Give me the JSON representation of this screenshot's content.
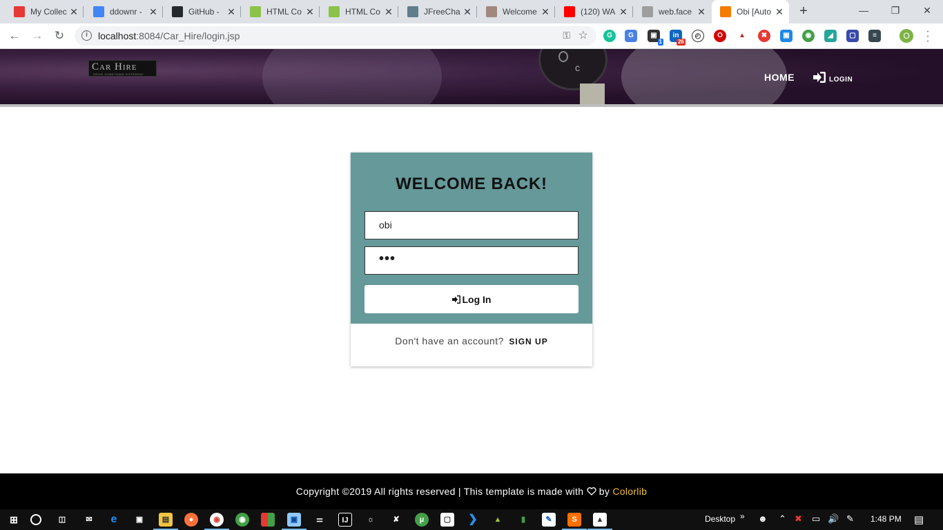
{
  "browser": {
    "tabs": [
      {
        "title": "My Collec",
        "icon": "red-collection-icon",
        "color": "#e53935"
      },
      {
        "title": "ddownr -",
        "icon": "ddownr-icon",
        "color": "#4285f4"
      },
      {
        "title": "GitHub -",
        "icon": "github-icon",
        "color": "#24292e"
      },
      {
        "title": "HTML Co",
        "icon": "html-code-icon",
        "color": "#8bc34a"
      },
      {
        "title": "HTML Co",
        "icon": "html-code-icon",
        "color": "#8bc34a"
      },
      {
        "title": "JFreeCha",
        "icon": "jfreechart-icon",
        "color": "#607d8b"
      },
      {
        "title": "Welcome",
        "icon": "welcome-icon",
        "color": "#a1887f"
      },
      {
        "title": "(120) WA",
        "icon": "youtube-icon",
        "color": "#ff0000"
      },
      {
        "title": "web.face",
        "icon": "facebook-icon",
        "color": "#9e9e9e"
      },
      {
        "title": "Obi [Auto",
        "icon": "blogger-icon",
        "color": "#f57c00"
      }
    ],
    "active_tab": 9,
    "url_host": "localhost",
    "url_path": ":8084/Car_Hire/login.jsp",
    "extension_badges": {
      "linkedin": "26",
      "box": "1"
    },
    "profile_initial": "O"
  },
  "header": {
    "logo_text": "Car Hire",
    "logo_tagline": "DRIVE SOMETHING DIFFERENT",
    "nav_home": "HOME",
    "nav_login": "LOGIN"
  },
  "login": {
    "title": "WELCOME BACK!",
    "username_value": "obi",
    "password_mask": "•••",
    "button_label": "Log In",
    "footer_prompt": "Don't have an account?",
    "signup_link": "SIGN UP",
    "panel_color": "#669999"
  },
  "footer": {
    "copyright": "Copyright ©2019 All rights reserved | This template is made with",
    "by": "by",
    "brand": "Colorlib",
    "brand_color": "#f0c030"
  },
  "taskbar": {
    "desktop_label": "Desktop",
    "chevron": "»",
    "time": "1:48 PM"
  }
}
